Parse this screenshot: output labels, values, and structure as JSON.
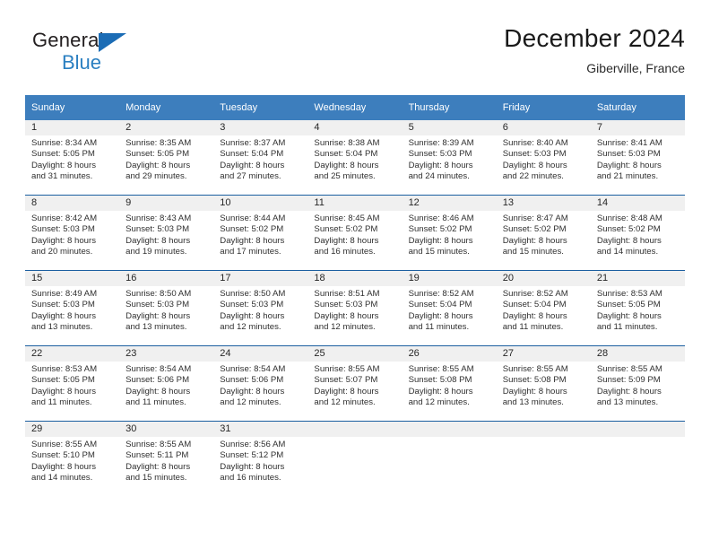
{
  "brand": {
    "name_part1": "General",
    "name_part2": "Blue",
    "logo_icon": "triangle-logo-icon"
  },
  "header": {
    "title": "December 2024",
    "subtitle": "Giberville, France"
  },
  "colors": {
    "header_blue": "#3d7ebd",
    "separator_blue": "#1b5fa0",
    "daynum_band": "#f0f0f0",
    "brand_blue": "#2a7fc1",
    "brand_dark": "#231f20"
  },
  "weekday_headers": [
    "Sunday",
    "Monday",
    "Tuesday",
    "Wednesday",
    "Thursday",
    "Friday",
    "Saturday"
  ],
  "weeks": [
    [
      {
        "day": "1",
        "sunrise": "Sunrise: 8:34 AM",
        "sunset": "Sunset: 5:05 PM",
        "daylight_line1": "Daylight: 8 hours",
        "daylight_line2": "and 31 minutes."
      },
      {
        "day": "2",
        "sunrise": "Sunrise: 8:35 AM",
        "sunset": "Sunset: 5:05 PM",
        "daylight_line1": "Daylight: 8 hours",
        "daylight_line2": "and 29 minutes."
      },
      {
        "day": "3",
        "sunrise": "Sunrise: 8:37 AM",
        "sunset": "Sunset: 5:04 PM",
        "daylight_line1": "Daylight: 8 hours",
        "daylight_line2": "and 27 minutes."
      },
      {
        "day": "4",
        "sunrise": "Sunrise: 8:38 AM",
        "sunset": "Sunset: 5:04 PM",
        "daylight_line1": "Daylight: 8 hours",
        "daylight_line2": "and 25 minutes."
      },
      {
        "day": "5",
        "sunrise": "Sunrise: 8:39 AM",
        "sunset": "Sunset: 5:03 PM",
        "daylight_line1": "Daylight: 8 hours",
        "daylight_line2": "and 24 minutes."
      },
      {
        "day": "6",
        "sunrise": "Sunrise: 8:40 AM",
        "sunset": "Sunset: 5:03 PM",
        "daylight_line1": "Daylight: 8 hours",
        "daylight_line2": "and 22 minutes."
      },
      {
        "day": "7",
        "sunrise": "Sunrise: 8:41 AM",
        "sunset": "Sunset: 5:03 PM",
        "daylight_line1": "Daylight: 8 hours",
        "daylight_line2": "and 21 minutes."
      }
    ],
    [
      {
        "day": "8",
        "sunrise": "Sunrise: 8:42 AM",
        "sunset": "Sunset: 5:03 PM",
        "daylight_line1": "Daylight: 8 hours",
        "daylight_line2": "and 20 minutes."
      },
      {
        "day": "9",
        "sunrise": "Sunrise: 8:43 AM",
        "sunset": "Sunset: 5:03 PM",
        "daylight_line1": "Daylight: 8 hours",
        "daylight_line2": "and 19 minutes."
      },
      {
        "day": "10",
        "sunrise": "Sunrise: 8:44 AM",
        "sunset": "Sunset: 5:02 PM",
        "daylight_line1": "Daylight: 8 hours",
        "daylight_line2": "and 17 minutes."
      },
      {
        "day": "11",
        "sunrise": "Sunrise: 8:45 AM",
        "sunset": "Sunset: 5:02 PM",
        "daylight_line1": "Daylight: 8 hours",
        "daylight_line2": "and 16 minutes."
      },
      {
        "day": "12",
        "sunrise": "Sunrise: 8:46 AM",
        "sunset": "Sunset: 5:02 PM",
        "daylight_line1": "Daylight: 8 hours",
        "daylight_line2": "and 15 minutes."
      },
      {
        "day": "13",
        "sunrise": "Sunrise: 8:47 AM",
        "sunset": "Sunset: 5:02 PM",
        "daylight_line1": "Daylight: 8 hours",
        "daylight_line2": "and 15 minutes."
      },
      {
        "day": "14",
        "sunrise": "Sunrise: 8:48 AM",
        "sunset": "Sunset: 5:02 PM",
        "daylight_line1": "Daylight: 8 hours",
        "daylight_line2": "and 14 minutes."
      }
    ],
    [
      {
        "day": "15",
        "sunrise": "Sunrise: 8:49 AM",
        "sunset": "Sunset: 5:03 PM",
        "daylight_line1": "Daylight: 8 hours",
        "daylight_line2": "and 13 minutes."
      },
      {
        "day": "16",
        "sunrise": "Sunrise: 8:50 AM",
        "sunset": "Sunset: 5:03 PM",
        "daylight_line1": "Daylight: 8 hours",
        "daylight_line2": "and 13 minutes."
      },
      {
        "day": "17",
        "sunrise": "Sunrise: 8:50 AM",
        "sunset": "Sunset: 5:03 PM",
        "daylight_line1": "Daylight: 8 hours",
        "daylight_line2": "and 12 minutes."
      },
      {
        "day": "18",
        "sunrise": "Sunrise: 8:51 AM",
        "sunset": "Sunset: 5:03 PM",
        "daylight_line1": "Daylight: 8 hours",
        "daylight_line2": "and 12 minutes."
      },
      {
        "day": "19",
        "sunrise": "Sunrise: 8:52 AM",
        "sunset": "Sunset: 5:04 PM",
        "daylight_line1": "Daylight: 8 hours",
        "daylight_line2": "and 11 minutes."
      },
      {
        "day": "20",
        "sunrise": "Sunrise: 8:52 AM",
        "sunset": "Sunset: 5:04 PM",
        "daylight_line1": "Daylight: 8 hours",
        "daylight_line2": "and 11 minutes."
      },
      {
        "day": "21",
        "sunrise": "Sunrise: 8:53 AM",
        "sunset": "Sunset: 5:05 PM",
        "daylight_line1": "Daylight: 8 hours",
        "daylight_line2": "and 11 minutes."
      }
    ],
    [
      {
        "day": "22",
        "sunrise": "Sunrise: 8:53 AM",
        "sunset": "Sunset: 5:05 PM",
        "daylight_line1": "Daylight: 8 hours",
        "daylight_line2": "and 11 minutes."
      },
      {
        "day": "23",
        "sunrise": "Sunrise: 8:54 AM",
        "sunset": "Sunset: 5:06 PM",
        "daylight_line1": "Daylight: 8 hours",
        "daylight_line2": "and 11 minutes."
      },
      {
        "day": "24",
        "sunrise": "Sunrise: 8:54 AM",
        "sunset": "Sunset: 5:06 PM",
        "daylight_line1": "Daylight: 8 hours",
        "daylight_line2": "and 12 minutes."
      },
      {
        "day": "25",
        "sunrise": "Sunrise: 8:55 AM",
        "sunset": "Sunset: 5:07 PM",
        "daylight_line1": "Daylight: 8 hours",
        "daylight_line2": "and 12 minutes."
      },
      {
        "day": "26",
        "sunrise": "Sunrise: 8:55 AM",
        "sunset": "Sunset: 5:08 PM",
        "daylight_line1": "Daylight: 8 hours",
        "daylight_line2": "and 12 minutes."
      },
      {
        "day": "27",
        "sunrise": "Sunrise: 8:55 AM",
        "sunset": "Sunset: 5:08 PM",
        "daylight_line1": "Daylight: 8 hours",
        "daylight_line2": "and 13 minutes."
      },
      {
        "day": "28",
        "sunrise": "Sunrise: 8:55 AM",
        "sunset": "Sunset: 5:09 PM",
        "daylight_line1": "Daylight: 8 hours",
        "daylight_line2": "and 13 minutes."
      }
    ],
    [
      {
        "day": "29",
        "sunrise": "Sunrise: 8:55 AM",
        "sunset": "Sunset: 5:10 PM",
        "daylight_line1": "Daylight: 8 hours",
        "daylight_line2": "and 14 minutes."
      },
      {
        "day": "30",
        "sunrise": "Sunrise: 8:55 AM",
        "sunset": "Sunset: 5:11 PM",
        "daylight_line1": "Daylight: 8 hours",
        "daylight_line2": "and 15 minutes."
      },
      {
        "day": "31",
        "sunrise": "Sunrise: 8:56 AM",
        "sunset": "Sunset: 5:12 PM",
        "daylight_line1": "Daylight: 8 hours",
        "daylight_line2": "and 16 minutes."
      },
      {
        "day": "",
        "sunrise": "",
        "sunset": "",
        "daylight_line1": "",
        "daylight_line2": ""
      },
      {
        "day": "",
        "sunrise": "",
        "sunset": "",
        "daylight_line1": "",
        "daylight_line2": ""
      },
      {
        "day": "",
        "sunrise": "",
        "sunset": "",
        "daylight_line1": "",
        "daylight_line2": ""
      },
      {
        "day": "",
        "sunrise": "",
        "sunset": "",
        "daylight_line1": "",
        "daylight_line2": ""
      }
    ]
  ]
}
